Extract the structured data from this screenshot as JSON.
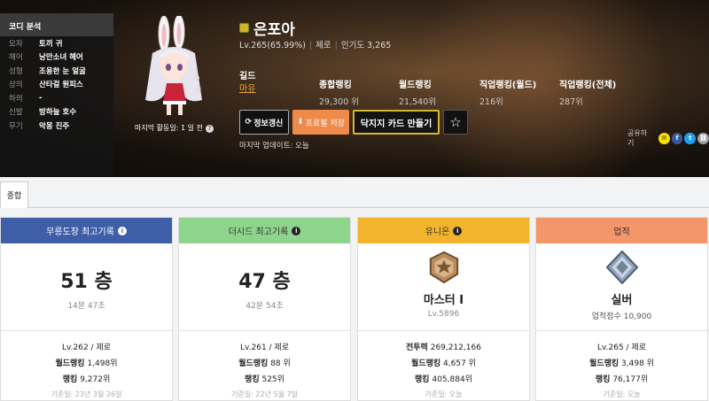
{
  "coordi": {
    "title": "코디 분석",
    "rows": [
      {
        "key": "모자",
        "val": "토끼 귀"
      },
      {
        "key": "헤어",
        "val": "낭만소녀 헤어"
      },
      {
        "key": "성형",
        "val": "조용한 눈 얼굴"
      },
      {
        "key": "상의",
        "val": "산타걸 원피스"
      },
      {
        "key": "하의",
        "val": "-"
      },
      {
        "key": "신발",
        "val": "방하늘 호수"
      },
      {
        "key": "무기",
        "val": "악몽 진주"
      }
    ]
  },
  "character": {
    "last_active": "마지막 활동일: 1 일 전",
    "name": "은포아",
    "level": "Lv.265(65.99%)",
    "job": "제로",
    "popularity": "인기도 3,265",
    "guild_label": "길드",
    "guild": "마유"
  },
  "rankings": [
    {
      "label": "종합랭킹",
      "value": "29,300 위"
    },
    {
      "label": "월드랭킹",
      "value": "21,540위"
    },
    {
      "label": "직업랭킹(월드)",
      "value": "216위"
    },
    {
      "label": "직업랭킹(전체)",
      "value": "287위"
    }
  ],
  "buttons": {
    "refresh": "정보갱신",
    "save": "프로필 저장",
    "card": "닥지지 카드 만들기"
  },
  "last_update": "마지막 업데이트: 오늘",
  "share": {
    "label": "공유하기"
  },
  "tabs": [
    {
      "label": "종합"
    }
  ],
  "cards": [
    {
      "title": "무릉도장 최고기록",
      "color": "#3f5ea8",
      "big": "51 층",
      "small": "14분 47초",
      "level": "Lv.262 / 제로",
      "l1_label": "월드랭킹",
      "l1_val": "1,498위",
      "l2_label": "랭킹",
      "l2_val": "9,272위",
      "date": "기준일: 23년 3월 26일"
    },
    {
      "title": "더시드 최고기록",
      "color": "#8fd48c",
      "big": "47 층",
      "small": "42분 54초",
      "level": "Lv.261 / 제로",
      "l1_label": "월드랭킹",
      "l1_val": "88 위",
      "l2_label": "랭킹",
      "l2_val": "525위",
      "date": "기준일: 22년 5월 7일"
    },
    {
      "title": "유니온",
      "color": "#f2b42c",
      "big": "마스터 I",
      "small": "Lv.5896",
      "level_label": "전투력",
      "level_val": "269,212,166",
      "l1_label": "월드랭킹",
      "l1_val": "4,657 위",
      "l2_label": "랭킹",
      "l2_val": "405,884위",
      "date": "기준일: 오늘"
    },
    {
      "title": "업적",
      "color": "#f5956a",
      "big": "실버",
      "small": "업적점수 10,900",
      "level": "Lv.265 / 제로",
      "l1_label": "월드랭킹",
      "l1_val": "3,498 위",
      "l2_label": "랭킹",
      "l2_val": "76,177위",
      "date": "기준일: 오늘"
    }
  ]
}
